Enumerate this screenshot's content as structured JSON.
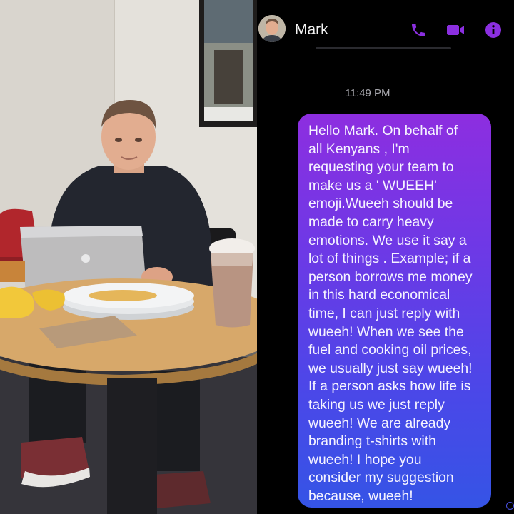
{
  "chat": {
    "contact_name": "Mark",
    "timestamp": "11:49 PM",
    "message": "Hello Mark. On behalf of\nall Kenyans , I'm\nrequesting your team to\nmake us a ' WUEEH'\nemoji.Wueeh should be\nmade to carry heavy\nemotions. We use it say a\nlot of things . Example; if a\nperson borrows me money\nin this hard economical\ntime, I can just reply with\nwueeh! When we see the\nfuel and cooking oil prices,\nwe usually just say wueeh!\nIf a person asks how life is\ntaking us we just reply\nwueeh!  We are already\nbranding t-shirts with\nwueeh! I hope you\nconsider my suggestion\nbecause, wueeh!",
    "header_icons": [
      "phone-icon",
      "video-camera-icon",
      "info-icon"
    ],
    "accent_color": "#8b2fe0",
    "bubble_gradient": [
      "#8d2ee0",
      "#3554e6"
    ]
  },
  "photo": {
    "subject": "man-at-laptop"
  }
}
